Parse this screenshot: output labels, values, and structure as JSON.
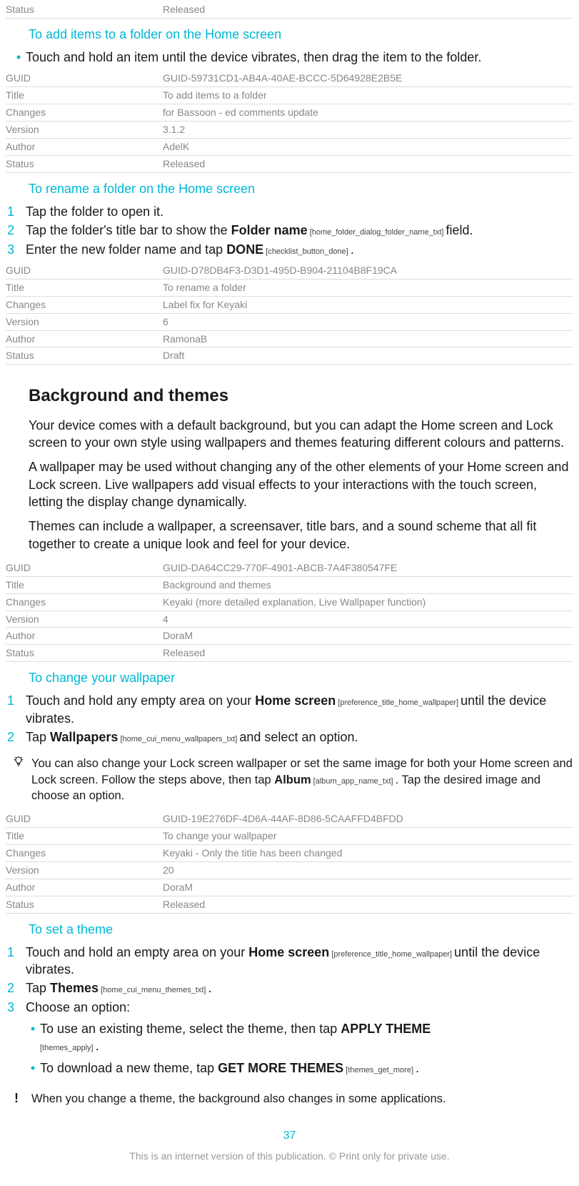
{
  "meta0": {
    "status_k": "Status",
    "status_v": "Released"
  },
  "sec1": {
    "title": "To add items to a folder on the Home screen",
    "bullet": "Touch and hold an item until the device vibrates, then drag the item to the folder."
  },
  "meta1": {
    "guid_k": "GUID",
    "guid_v": "GUID-59731CD1-AB4A-40AE-BCCC-5D64928E2B5E",
    "title_k": "Title",
    "title_v": "To add items to a folder",
    "changes_k": "Changes",
    "changes_v": "for Bassoon - ed comments update",
    "version_k": "Version",
    "version_v": "3.1.2",
    "author_k": "Author",
    "author_v": "AdelK",
    "status_k": "Status",
    "status_v": "Released"
  },
  "sec2": {
    "title": "To rename a folder on the Home screen",
    "step1": "Tap the folder to open it.",
    "step2a": "Tap the folder's title bar to show the ",
    "step2b": "Folder name",
    "step2ref": " [home_folder_dialog_folder_name_txt] ",
    "step2c": "field.",
    "step3a": "Enter the new folder name and tap ",
    "step3b": "DONE",
    "step3ref": " [checklist_button_done] ",
    "step3c": "."
  },
  "meta2": {
    "guid_k": "GUID",
    "guid_v": "GUID-D78DB4F3-D3D1-495D-B904-21104B8F19CA",
    "title_k": "Title",
    "title_v": "To rename a folder",
    "changes_k": "Changes",
    "changes_v": "Label fix for Keyaki",
    "version_k": "Version",
    "version_v": "6",
    "author_k": "Author",
    "author_v": "RamonaB",
    "status_k": "Status",
    "status_v": "Draft"
  },
  "sec3": {
    "h2": "Background and themes",
    "p1": "Your device comes with a default background, but you can adapt the Home screen and Lock screen to your own style using wallpapers and themes featuring different colours and patterns.",
    "p2": "A wallpaper may be used without changing any of the other elements of your Home screen and Lock screen. Live wallpapers add visual effects to your interactions with the touch screen, letting the display change dynamically.",
    "p3": "Themes can include a wallpaper, a screensaver, title bars, and a sound scheme that all fit together to create a unique look and feel for your device."
  },
  "meta3": {
    "guid_k": "GUID",
    "guid_v": "GUID-DA64CC29-770F-4901-ABCB-7A4F380547FE",
    "title_k": "Title",
    "title_v": "Background and themes",
    "changes_k": "Changes",
    "changes_v": "Keyaki (more detailed explanation, Live Wallpaper function)",
    "version_k": "Version",
    "version_v": "4",
    "author_k": "Author",
    "author_v": "DoraM",
    "status_k": "Status",
    "status_v": "Released"
  },
  "sec4": {
    "title": "To change your wallpaper",
    "s1a": "Touch and hold any empty area on your ",
    "s1b": "Home screen",
    "s1ref": " [preference_title_home_wallpaper] ",
    "s1c": "until the device vibrates.",
    "s2a": "Tap ",
    "s2b": "Wallpapers",
    "s2ref": " [home_cui_menu_wallpapers_txt] ",
    "s2c": "and select an option.",
    "tipa": "You can also change your Lock screen wallpaper or set the same image for both your Home screen and Lock screen. Follow the steps above, then tap ",
    "tipb": "Album",
    "tipref": " [album_app_name_txt] ",
    "tipc": ". Tap the desired image and choose an option."
  },
  "meta4": {
    "guid_k": "GUID",
    "guid_v": "GUID-19E276DF-4D6A-44AF-8D86-5CAAFFD4BFDD",
    "title_k": "Title",
    "title_v": "To change your wallpaper",
    "changes_k": "Changes",
    "changes_v": "Keyaki - Only the title has been changed",
    "version_k": "Version",
    "version_v": "20",
    "author_k": "Author",
    "author_v": "DoraM",
    "status_k": "Status",
    "status_v": "Released"
  },
  "sec5": {
    "title": "To set a theme",
    "s1a": "Touch and hold an empty area on your ",
    "s1b": "Home screen",
    "s1ref": " [preference_title_home_wallpaper] ",
    "s1c": "until the device vibrates.",
    "s2a": "Tap ",
    "s2b": "Themes",
    "s2ref": " [home_cui_menu_themes_txt] ",
    "s2c": ".",
    "s3": "Choose an option:",
    "s3b1a": "To use an existing theme, select the theme, then tap ",
    "s3b1b": "APPLY THEME",
    "s3b1ref": "[themes_apply] ",
    "s3b1c": ".",
    "s3b2a": "To download a new theme, tap ",
    "s3b2b": "GET MORE THEMES",
    "s3b2ref": " [themes_get_more] ",
    "s3b2c": ".",
    "warn": "When you change a theme, the background also changes in some applications."
  },
  "page": {
    "num": "37",
    "footer": "This is an internet version of this publication. © Print only for private use."
  }
}
